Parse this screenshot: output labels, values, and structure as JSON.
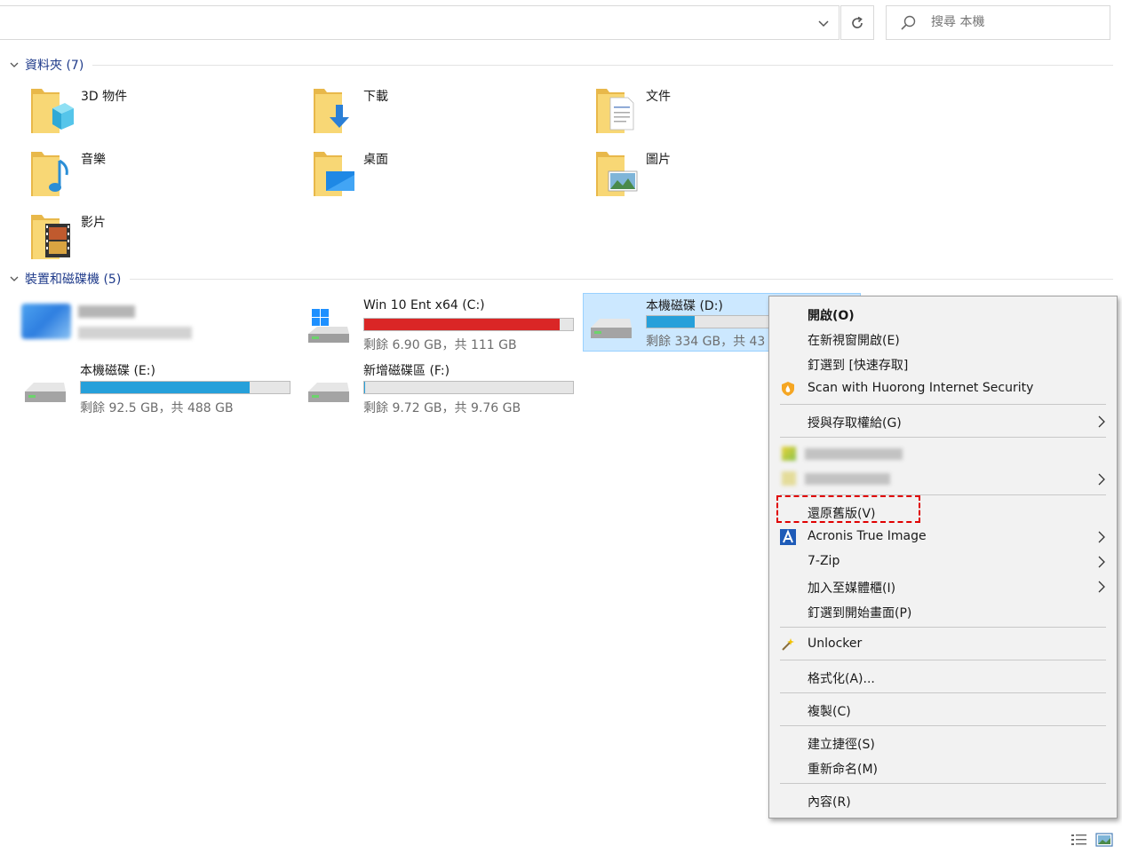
{
  "search": {
    "placeholder": "搜尋 本機"
  },
  "sections": {
    "folders": {
      "title": "資料夾 (7)"
    },
    "devices": {
      "title": "裝置和磁碟機 (5)"
    }
  },
  "folders": [
    {
      "label": "3D 物件",
      "icon": "folder-3d-objects-icon"
    },
    {
      "label": "下載",
      "icon": "folder-downloads-icon"
    },
    {
      "label": "文件",
      "icon": "folder-documents-icon"
    },
    {
      "label": "音樂",
      "icon": "folder-music-icon"
    },
    {
      "label": "桌面",
      "icon": "folder-desktop-icon"
    },
    {
      "label": "圖片",
      "icon": "folder-pictures-icon"
    },
    {
      "label": "影片",
      "icon": "folder-videos-icon"
    }
  ],
  "drives": [
    {
      "name": "Win 10 Ent x64 (C:)",
      "free": "剩餘 6.90 GB，共 111 GB",
      "used_fraction": 0.938,
      "bar_color": "#da2626"
    },
    {
      "name": "本機磁碟 (D:)",
      "free": "剩餘 334 GB，共 43",
      "used_fraction": 0.23,
      "bar_color": "#26a0da"
    },
    {
      "name": "本機磁碟 (E:)",
      "free": "剩餘 92.5 GB，共 488 GB",
      "used_fraction": 0.81,
      "bar_color": "#26a0da"
    },
    {
      "name": "新增磁碟區 (F:)",
      "free": "剩餘 9.72 GB，共 9.76 GB",
      "used_fraction": 0.004,
      "bar_color": "#26a0da"
    }
  ],
  "menu": {
    "open": "開啟(O)",
    "open_new_window": "在新視窗開啟(E)",
    "pin_quick_access": "釘選到 [快速存取]",
    "scan_huorong": "Scan with Huorong Internet Security",
    "give_access": "授與存取權給(G)",
    "restore_previous": "還原舊版(V)",
    "acronis": "Acronis True Image",
    "seven_zip": "7-Zip",
    "add_to_library": "加入至媒體櫃(I)",
    "pin_start": "釘選到開始畫面(P)",
    "unlocker": "Unlocker",
    "format": "格式化(A)...",
    "copy": "複製(C)",
    "create_shortcut": "建立捷徑(S)",
    "rename": "重新命名(M)",
    "properties": "內容(R)"
  },
  "colors": {
    "accent": "#26a0da",
    "danger": "#da2626",
    "selection": "#cce8ff",
    "highlight": "#e00000"
  }
}
